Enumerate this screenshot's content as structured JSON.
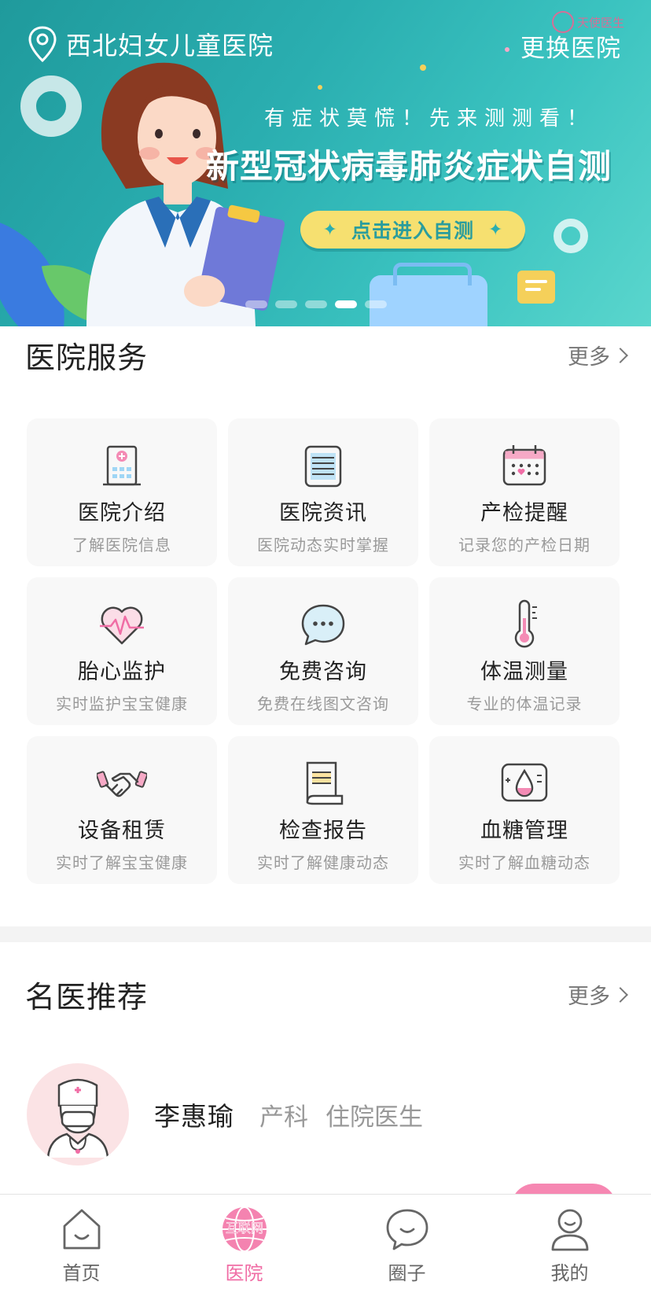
{
  "banner": {
    "hospital_name": "西北妇女儿童医院",
    "change_hospital": "更换医院",
    "watermark": "天使医生",
    "subtitle": "有症状莫慌！先来测测看！",
    "title": "新型冠状病毒肺炎症状自测",
    "cta_label": "点击进入自测",
    "pager_count": 5,
    "pager_active": 4
  },
  "services": {
    "title": "医院服务",
    "more": "更多",
    "items": [
      {
        "title": "医院介绍",
        "desc": "了解医院信息",
        "icon": "hospital-icon"
      },
      {
        "title": "医院资讯",
        "desc": "医院动态实时掌握",
        "icon": "news-icon"
      },
      {
        "title": "产检提醒",
        "desc": "记录您的产检日期",
        "icon": "calendar-icon"
      },
      {
        "title": "胎心监护",
        "desc": "实时监护宝宝健康",
        "icon": "heartbeat-icon"
      },
      {
        "title": "免费咨询",
        "desc": "免费在线图文咨询",
        "icon": "chat-icon"
      },
      {
        "title": "体温测量",
        "desc": "专业的体温记录",
        "icon": "thermometer-icon"
      },
      {
        "title": "设备租赁",
        "desc": "实时了解宝宝健康",
        "icon": "handshake-icon"
      },
      {
        "title": "检查报告",
        "desc": "实时了解健康动态",
        "icon": "report-icon"
      },
      {
        "title": "血糖管理",
        "desc": "实时了解血糖动态",
        "icon": "blood-drop-icon"
      }
    ]
  },
  "doctors": {
    "title": "名医推荐",
    "more": "更多",
    "items": [
      {
        "name": "李惠瑜",
        "dept": "产科",
        "title": "住院医生"
      }
    ]
  },
  "tabbar": {
    "active": 1,
    "items": [
      {
        "label": "首页",
        "icon": "home-icon"
      },
      {
        "label": "医院",
        "icon": "hospital-globe-icon",
        "badge": "互联网"
      },
      {
        "label": "圈子",
        "icon": "chat-bubble-icon"
      },
      {
        "label": "我的",
        "icon": "profile-icon"
      }
    ]
  },
  "colors": {
    "banner_teal": "#2aaeb0",
    "cta_yellow": "#f6e070",
    "accent_pink": "#f06da5",
    "card_bg": "#f8f8f8"
  }
}
